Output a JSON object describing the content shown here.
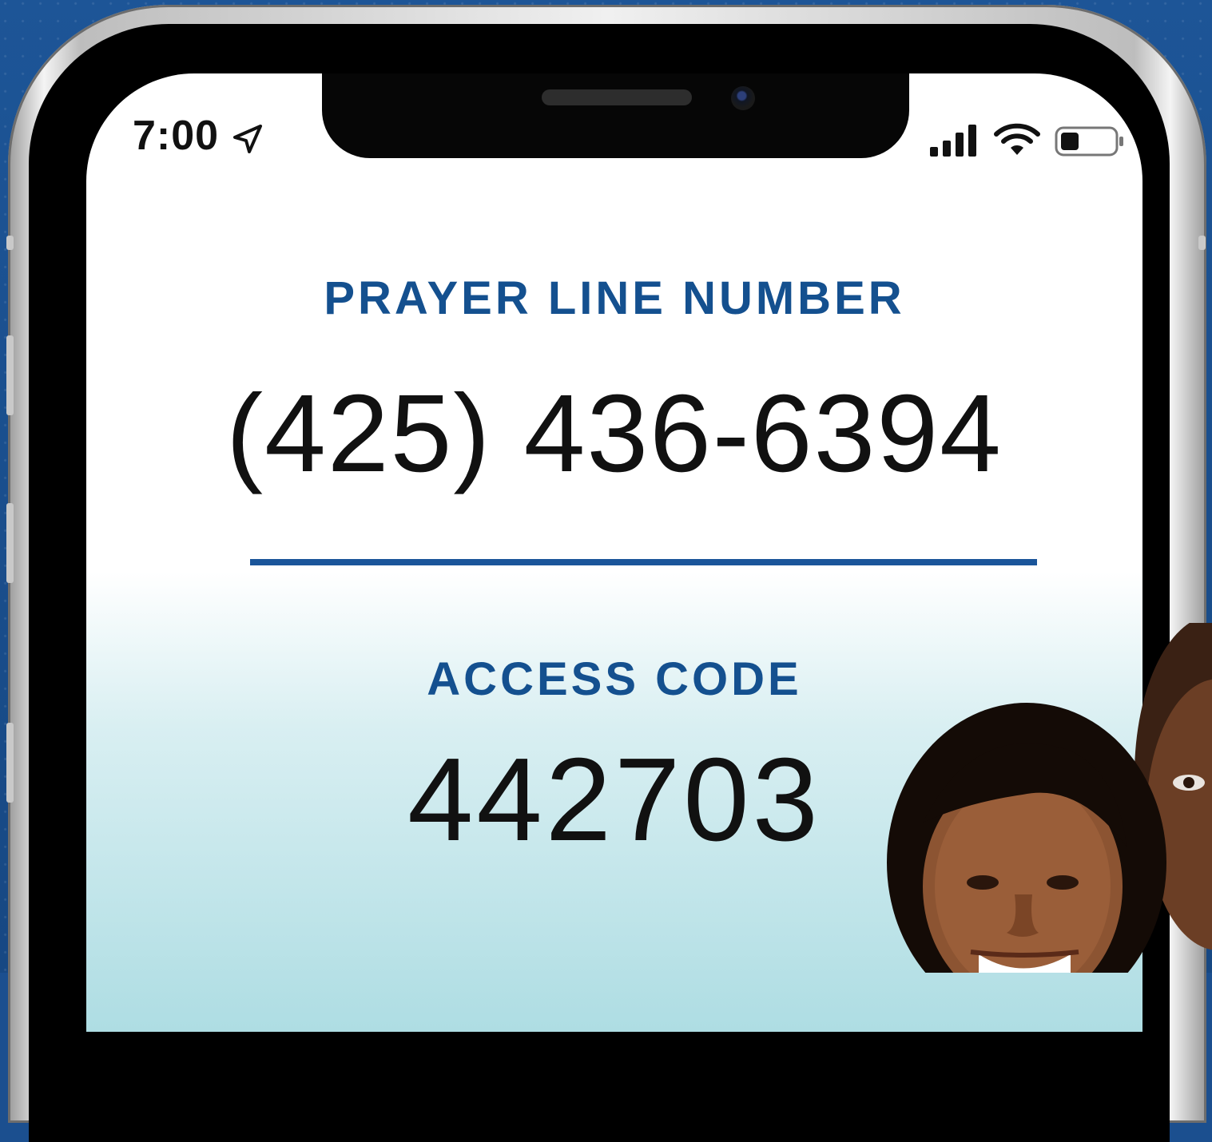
{
  "status_bar": {
    "time": "7:00",
    "location_icon": "location-arrow-icon",
    "signal_icon": "cellular-signal-icon",
    "wifi_icon": "wifi-icon",
    "battery_icon": "battery-icon"
  },
  "content": {
    "prayer_line_label": "PRAYER LINE NUMBER",
    "prayer_line_number": "(425) 436-6394",
    "access_code_label": "ACCESS CODE",
    "access_code": "442703"
  },
  "colors": {
    "background": "#1b4f8f",
    "accent": "#14508f",
    "text": "#111111"
  },
  "photo": {
    "description_icon": "people-photo"
  }
}
